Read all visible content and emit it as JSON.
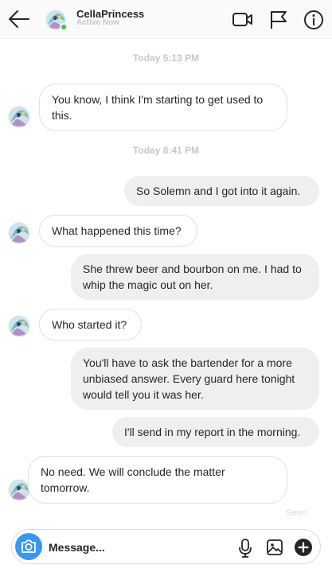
{
  "header": {
    "username": "CellaPrincess",
    "status": "Active Now"
  },
  "thread": {
    "time_1": "Today 5:13 PM",
    "msg_1": "You know, I think I'm starting to get used to this.",
    "time_2": "Today 8:41 PM",
    "msg_2": "So Solemn and I got into it again.",
    "msg_3": "What happened this time?",
    "msg_4": "She threw beer and bourbon on me. I had to whip the magic out on her.",
    "msg_5": "Who started it?",
    "msg_6": "You'll have to ask the bartender for a more unbiased answer. Every guard here tonight would tell you it was her.",
    "msg_7": "I'll send in my report in the morning.",
    "msg_8": "No need. We will conclude the matter tomorrow.",
    "seen": "Seen"
  },
  "composer": {
    "placeholder": "Message..."
  },
  "colors": {
    "accent": "#3897f0",
    "online": "#2ecc40",
    "outgoing_bubble": "#efefef",
    "incoming_border": "#e0e0e0"
  },
  "icons": [
    "back-arrow-icon",
    "video-icon",
    "flag-icon",
    "info-icon",
    "camera-icon",
    "mic-icon",
    "gallery-icon",
    "plus-icon"
  ]
}
